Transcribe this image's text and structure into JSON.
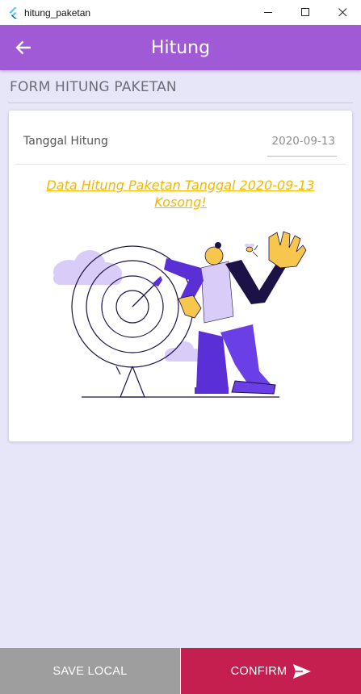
{
  "window": {
    "title": "hitung_paketan",
    "icons": [
      "flutter-logo-icon",
      "minimize-icon",
      "maximize-icon",
      "close-icon"
    ]
  },
  "appbar": {
    "title": "Hitung",
    "back_icon": "arrow-left-icon",
    "color": "#a05ad6"
  },
  "section": {
    "title": "FORM HITUNG PAKETAN"
  },
  "form": {
    "date_label": "Tanggal Hitung",
    "date_value": "2020-09-13"
  },
  "empty_state": {
    "message": "Data Hitung Paketan Tanggal 2020-09-13 Kosong!",
    "color": "#f5b800",
    "illustration": "person-throwing-dart-at-target"
  },
  "actions": {
    "save_label": "SAVE LOCAL",
    "confirm_label": "CONFIRM",
    "confirm_icon": "send-icon",
    "save_color": "#9e9e9e",
    "confirm_color": "#c41f4f"
  }
}
